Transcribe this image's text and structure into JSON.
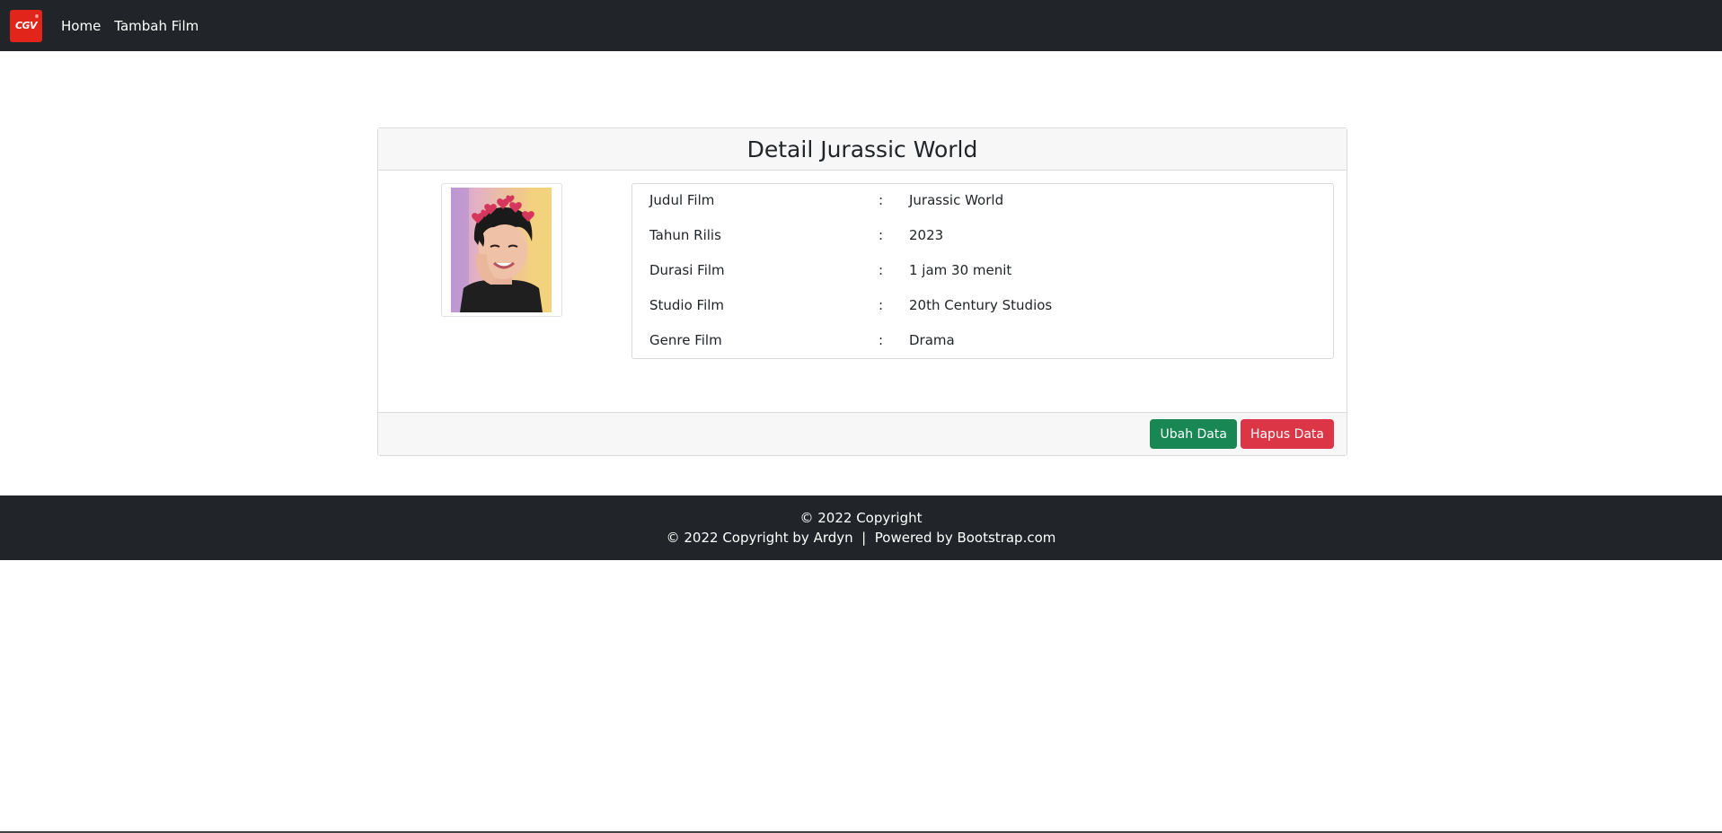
{
  "navbar": {
    "brand_text": "CGV",
    "brand_color": "#e1251b",
    "links": [
      "Home",
      "Tambah Film"
    ]
  },
  "card": {
    "title": "Detail Jurassic World",
    "photo_alt": "Poster",
    "details": [
      {
        "label": "Judul Film",
        "sep": ":",
        "value": "Jurassic World"
      },
      {
        "label": "Tahun Rilis",
        "sep": ":",
        "value": "2023"
      },
      {
        "label": "Durasi Film",
        "sep": ":",
        "value": "1 jam 30 menit"
      },
      {
        "label": "Studio Film",
        "sep": ":",
        "value": "20th Century Studios"
      },
      {
        "label": "Genre Film",
        "sep": ":",
        "value": "Drama"
      }
    ],
    "buttons": {
      "edit_label": "Ubah Data",
      "edit_color": "#198754",
      "delete_label": "Hapus Data",
      "delete_color": "#dc3545"
    }
  },
  "footer": {
    "line1": "© 2022 Copyright",
    "line2": "© 2022 Copyright by Ardyn  |  Powered by Bootstrap.com"
  }
}
